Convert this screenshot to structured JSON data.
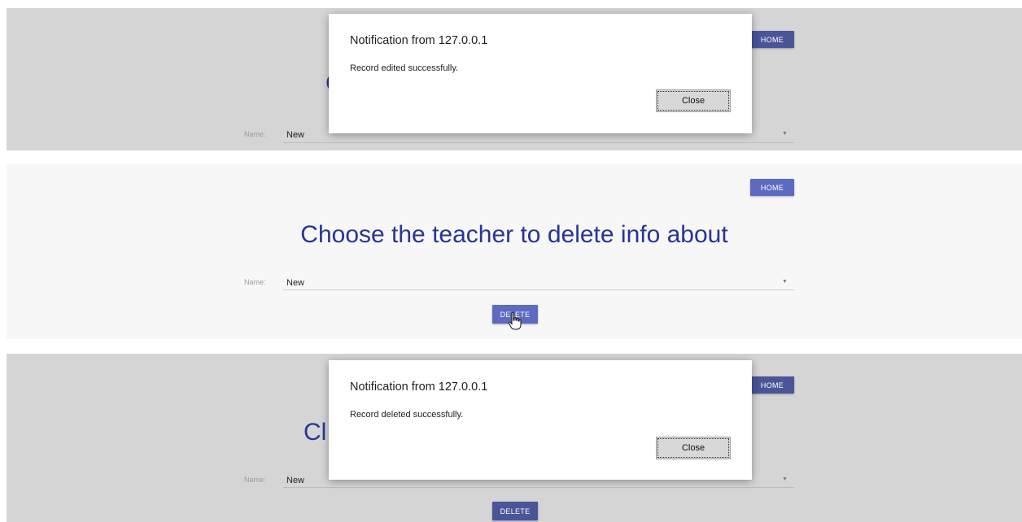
{
  "frames": [
    {
      "home_label": "HOME",
      "heading_fragment": "C",
      "name_label": "Name:",
      "name_value": "New",
      "dialog": {
        "title": "Notification from 127.0.0.1",
        "message": "Record edited successfully.",
        "close_label": "Close"
      }
    },
    {
      "home_label": "HOME",
      "heading": "Choose the teacher to delete info about",
      "name_label": "Name:",
      "name_value": "New",
      "delete_label": "DELETE"
    },
    {
      "home_label": "HOME",
      "heading_fragment": "Cl",
      "name_label": "Name:",
      "name_value": "New",
      "delete_label": "DELETE",
      "dialog": {
        "title": "Notification from 127.0.0.1",
        "message": "Record deleted successfully.",
        "close_label": "Close"
      }
    }
  ],
  "colors": {
    "accent_button": "#5c6bc0",
    "heading_text": "#283593",
    "dimmed_backdrop": "#d5d5d5",
    "page_background": "#f7f7f7"
  },
  "icons": [
    "dropdown-arrow-icon",
    "hand-pointer-cursor-icon"
  ]
}
